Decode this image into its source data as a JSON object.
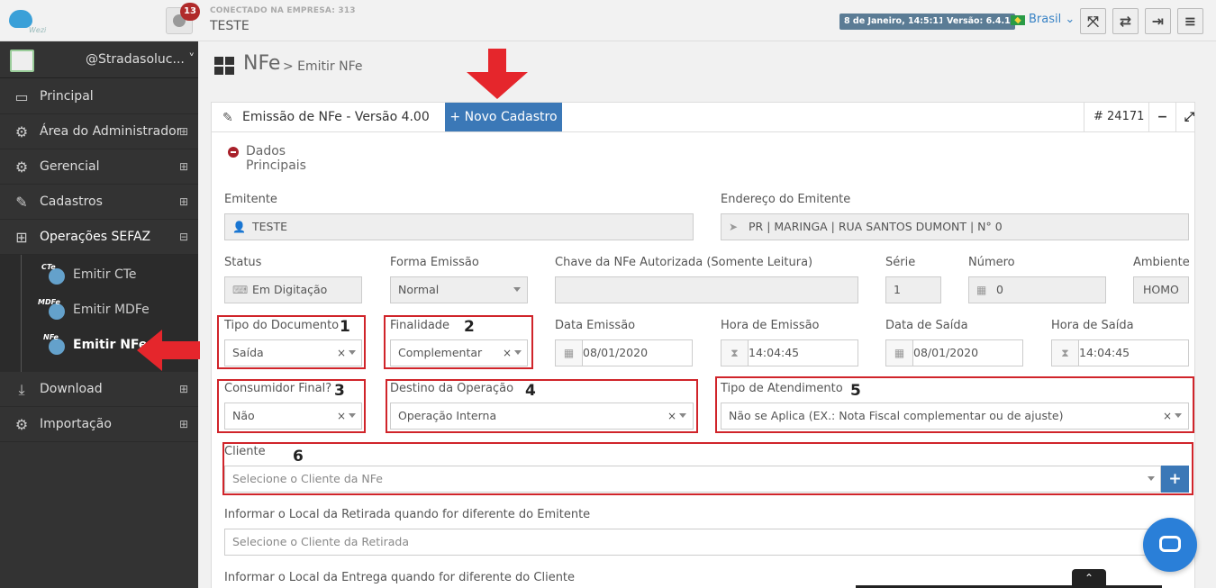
{
  "topbar": {
    "logo_text": "Wezi",
    "notifications_count": "13",
    "company_label": "CONECTADO NA EMPRESA: 313",
    "company_name": "TESTE",
    "date_pill": "8 de Janeiro, 14:5:11",
    "version_pill": "Versão: 6.4.1",
    "country": "Brasil ⌄",
    "buttons": [
      "expand-icon",
      "refresh-icon",
      "logout-icon",
      "menu-icon"
    ]
  },
  "sidebar": {
    "profile_name": "@Stradasoluc... ˅",
    "items": [
      {
        "label": "Principal",
        "icon": "desktop-icon",
        "expand": ""
      },
      {
        "label": "Área do Administrador",
        "icon": "gears-icon",
        "expand": "⊞"
      },
      {
        "label": "Gerencial",
        "icon": "gears-icon",
        "expand": "⊞"
      },
      {
        "label": "Cadastros",
        "icon": "edit-icon",
        "expand": "⊞"
      },
      {
        "label": "Operações SEFAZ",
        "icon": "windows-icon",
        "expand": "⊟"
      },
      {
        "label": "Download",
        "icon": "download-icon",
        "expand": "⊞"
      },
      {
        "label": "Importação",
        "icon": "gears-icon",
        "expand": "⊞"
      }
    ],
    "subitems": [
      {
        "label": "Emitir CTe",
        "tag": "CTe"
      },
      {
        "label": "Emitir MDFe",
        "tag": "MDFe"
      },
      {
        "label": "Emitir NFe",
        "tag": "NFe"
      }
    ]
  },
  "page": {
    "title": "NFe",
    "breadcrumb": "> Emitir NFe"
  },
  "panel": {
    "title": "Emissão de NFe - Versão 4.00",
    "new_button": "+ Novo Cadastro",
    "record_id": "# 24171",
    "minimize": "−",
    "fullscreen": "⤢",
    "section": "Dados Principais"
  },
  "form": {
    "emitente_label": "Emitente",
    "emitente_value": "TESTE",
    "endereco_label": "Endereço do Emitente",
    "endereco_value": "PR | MARINGA | RUA SANTOS DUMONT | N° 0",
    "status_label": "Status",
    "status_value": "Em Digitação",
    "forma_label": "Forma Emissão",
    "forma_value": "Normal",
    "chave_label": "Chave da NFe Autorizada (Somente Leitura)",
    "chave_value": "",
    "serie_label": "Série",
    "serie_value": "1",
    "numero_label": "Número",
    "numero_value": "0",
    "ambiente_label": "Ambiente",
    "ambiente_value": "HOMO",
    "tipo_doc_label": "Tipo do Documento",
    "tipo_doc_value": "Saída",
    "finalidade_label": "Finalidade",
    "finalidade_value": "Complementar",
    "data_emissao_label": "Data Emissão",
    "data_emissao_value": "08/01/2020",
    "hora_emissao_label": "Hora de Emissão",
    "hora_emissao_value": "14:04:45",
    "data_saida_label": "Data de Saída",
    "data_saida_value": "08/01/2020",
    "hora_saida_label": "Hora de Saída",
    "hora_saida_value": "14:04:45",
    "consumidor_label": "Consumidor Final?",
    "consumidor_value": "Não",
    "destino_label": "Destino da Operação",
    "destino_value": "Operação Interna",
    "atendimento_label": "Tipo de Atendimento",
    "atendimento_value": "Não se Aplica (EX.: Nota Fiscal complementar ou de ajuste)",
    "cliente_label": "Cliente",
    "cliente_placeholder": "Selecione o Cliente da NFe",
    "retirada_label": "Informar o Local da Retirada quando for diferente do Emitente",
    "retirada_placeholder": "Selecione o Cliente da Retirada",
    "entrega_label": "Informar o Local da Entrega quando for diferente do Cliente",
    "clear_symbol": "×"
  },
  "annotations": [
    "1",
    "2",
    "3",
    "4",
    "5",
    "6"
  ],
  "colors": {
    "accent": "#3b78b7",
    "sidebar_bg": "#333333",
    "annotation_red": "#d0242a",
    "badge_red": "#b02a2a"
  }
}
